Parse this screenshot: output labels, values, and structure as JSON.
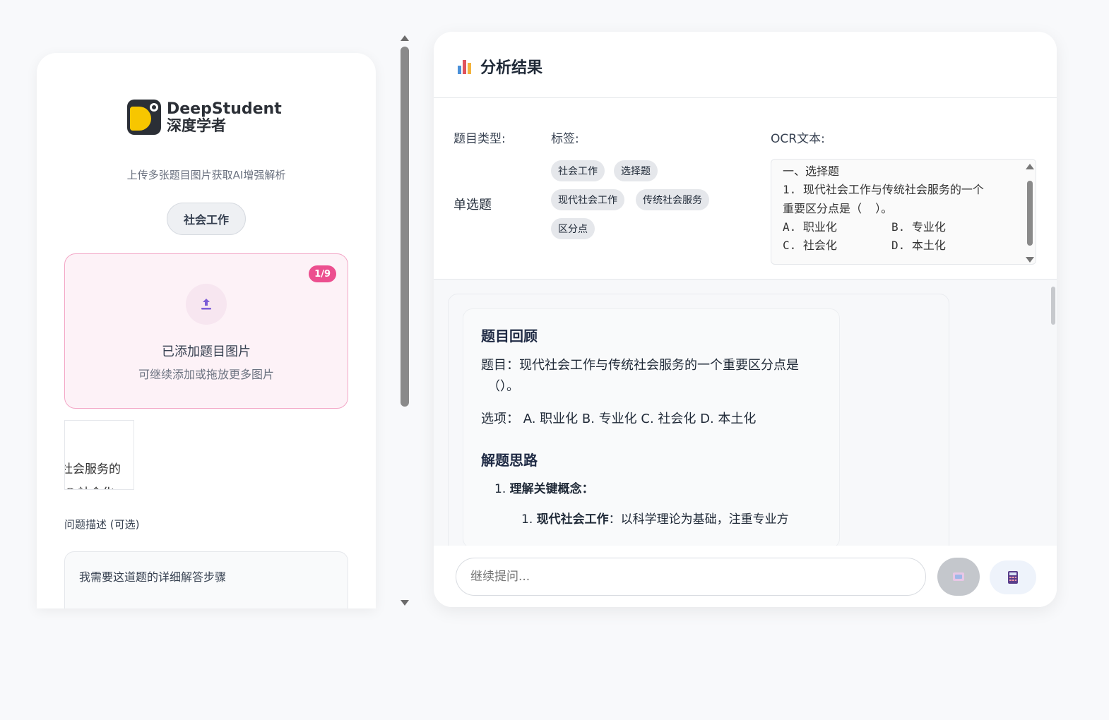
{
  "left": {
    "logo_en": "DeepStudent",
    "logo_cn": "深度学者",
    "subtitle": "上传多张题目图片获取AI增强解析",
    "subject_chip": "社会工作",
    "upload": {
      "count_badge": "1/9",
      "title": "已添加题目图片",
      "subtitle": "可继续添加或拖放更多图片",
      "icon": "upload-icon"
    },
    "thumbnail_text": [
      "社会服务的",
      "C 社会化"
    ],
    "description_label": "问题描述 (可选)",
    "description_value": "我需要这道题的详细解答步骤"
  },
  "right": {
    "header": {
      "icon": "bar-chart-icon",
      "title": "分析结果"
    },
    "question_type_label": "题目类型:",
    "question_type_value": "单选题",
    "tags_label": "标签:",
    "tags": [
      "社会工作",
      "选择题",
      "现代社会工作",
      "传统社会服务",
      "区分点"
    ],
    "ocr_label": "OCR文本:",
    "ocr_lines": [
      "一、选择题",
      "1. 现代社会工作与传统社会服务的一个",
      "重要区分点是（  ）。",
      "A. 职业化        B. 专业化",
      "C. 社会化        D. 本土化"
    ],
    "analysis": {
      "review_title": "题目回顾",
      "question_line1": "题目：现代社会工作与传统社会服务的一个重要区分点是",
      "question_line2": "（）。",
      "options": "选项：  A. 职业化 B. 专业化 C. 社会化 D. 本土化",
      "approach_title": "解题思路",
      "step1_number": "1.",
      "step1_label": "理解关键概念：",
      "sub1_number": "1.",
      "sub1_label": "现代社会工作",
      "sub1_text": "：以科学理论为基础，注重专业方"
    },
    "chat": {
      "placeholder": "继续提问...",
      "send_icon": "image-send-icon",
      "extra_icon": "calculator-icon"
    }
  },
  "colors": {
    "accent_pink": "#ec4f8f",
    "upload_border": "#f3a6c6",
    "upload_bg": "#fdf2f7",
    "upload_arrow": "#7c5cd6"
  }
}
